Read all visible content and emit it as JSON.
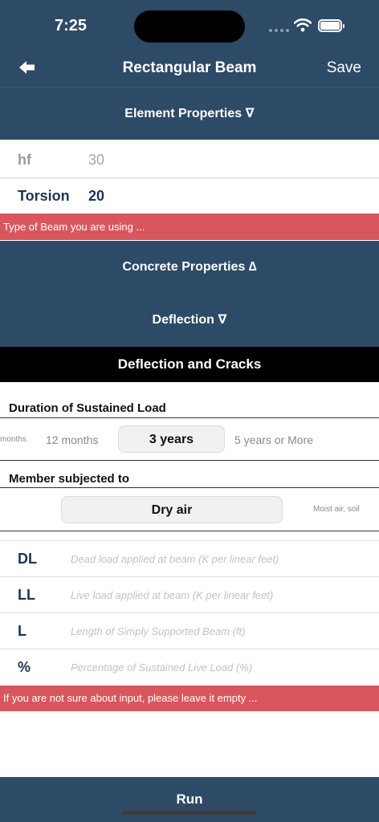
{
  "status": {
    "time": "7:25"
  },
  "nav": {
    "title": "Rectangular Beam",
    "save_label": "Save"
  },
  "sections": {
    "element_properties": "Element Properties ∇",
    "concrete_properties": "Concrete Properties ∆",
    "deflection": "Deflection ∇"
  },
  "element_rows": [
    {
      "label": "hf",
      "value": "30"
    },
    {
      "label": "Torsion",
      "value": "20"
    }
  ],
  "beam_type_hint": "Type of Beam you are using ...",
  "deflection_panel": {
    "title": "Deflection and Cracks",
    "duration": {
      "label": "Duration of Sustained Load",
      "options": [
        "months",
        "12 months",
        "3 years",
        "5 years or More"
      ],
      "selected": "3 years"
    },
    "member": {
      "label": "Member subjected to",
      "options": [
        "Dry air",
        "Moist air, soil"
      ],
      "selected": "Dry air"
    },
    "inputs": [
      {
        "label": "DL",
        "placeholder": "Dead load applied at beam (K per linear feet)"
      },
      {
        "label": "LL",
        "placeholder": "Live load applied at beam (K per linear feet)"
      },
      {
        "label": "L",
        "placeholder": "Length of Simply Supported Beam (ft)"
      },
      {
        "label": "%",
        "placeholder": "Percentage of Sustained Live Load (%)"
      }
    ],
    "hint": "If you are not sure about input, please leave it empty ..."
  },
  "run_label": "Run",
  "colors": {
    "navy": "#2d4a67",
    "banner_red": "#d8575d",
    "black_bar": "#000000"
  }
}
